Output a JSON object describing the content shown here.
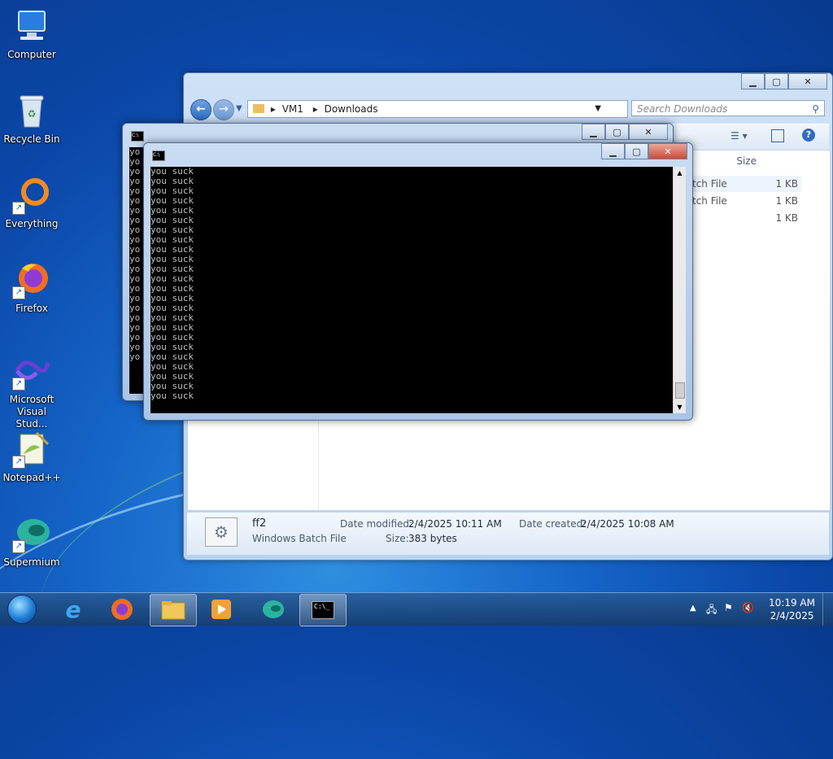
{
  "desktop": {
    "icons": [
      {
        "label": "Computer"
      },
      {
        "label": "Recycle Bin"
      },
      {
        "label": "Everything"
      },
      {
        "label": "Firefox"
      },
      {
        "label_line1": "Microsoft",
        "label_line2": "Visual Stud..."
      },
      {
        "label": "Notepad++"
      },
      {
        "label": "Supermium"
      }
    ]
  },
  "explorer": {
    "breadcrumb": [
      "VM1",
      "Downloads"
    ],
    "search_placeholder": "Search Downloads",
    "column_size": "Size",
    "rows": [
      {
        "type": "tch File",
        "size": "1 KB"
      },
      {
        "type": "tch File",
        "size": "1 KB"
      },
      {
        "type": "",
        "size": "1 KB"
      }
    ],
    "details": {
      "name": "ff2",
      "type": "Windows Batch File",
      "modified_label": "Date modified:",
      "modified_value": "2/4/2025 10:11 AM",
      "created_label": "Date created:",
      "created_value": "2/4/2025 10:08 AM",
      "size_label": "Size:",
      "size_value": "383 bytes"
    }
  },
  "cmd_back": {
    "icon_text": "C:\\",
    "line": "yo",
    "line_count": 22
  },
  "cmd_front": {
    "icon_text": "C:\\",
    "line": "you suck",
    "line_count": 24
  },
  "taskbar": {
    "time": "10:19 AM",
    "date": "2/4/2025"
  },
  "colors": {
    "desktop_blue": "#1565c8",
    "taskbar": "#1e4f86",
    "close_red": "#c94b36"
  }
}
